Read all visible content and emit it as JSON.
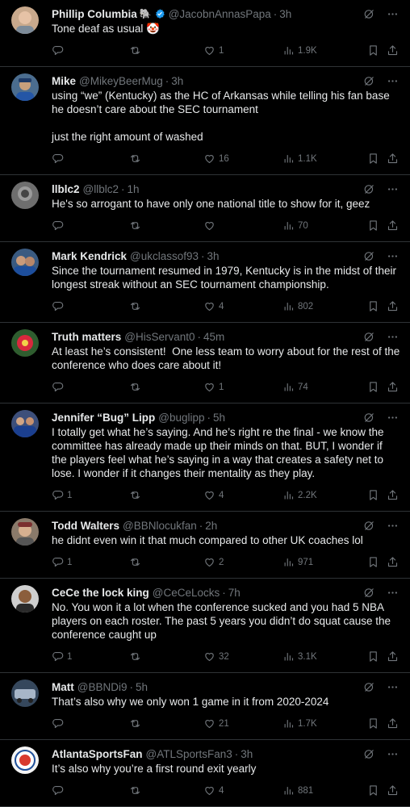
{
  "tweets": [
    {
      "name": "Phillip Columbia",
      "emoji": "🐘",
      "verified": true,
      "handle": "@JacobnAnnasPapa",
      "time": "3h",
      "text": "Tone deaf as usual 🤡",
      "replies": "",
      "retweets": "",
      "likes": "1",
      "views": "1.9K",
      "avatar": "avatar-a"
    },
    {
      "name": "Mike",
      "emoji": "",
      "verified": false,
      "handle": "@MikeyBeerMug",
      "time": "3h",
      "text": "using “we” (Kentucky) as the HC of Arkansas while telling his fan base he doesn’t care about the SEC tournament\n\njust the right amount of washed",
      "replies": "",
      "retweets": "",
      "likes": "16",
      "views": "1.1K",
      "avatar": "avatar-b"
    },
    {
      "name": "llblc2",
      "emoji": "",
      "verified": false,
      "handle": "@llblc2",
      "time": "1h",
      "text": "He's so arrogant to have only one national title to show for it, geez",
      "replies": "",
      "retweets": "",
      "likes": "",
      "views": "70",
      "avatar": "avatar-c"
    },
    {
      "name": "Mark Kendrick",
      "emoji": "",
      "verified": false,
      "handle": "@ukclassof93",
      "time": "3h",
      "text": "Since the tournament resumed in 1979, Kentucky is in the midst of their longest streak without an SEC tournament championship.",
      "replies": "",
      "retweets": "",
      "likes": "4",
      "views": "802",
      "avatar": "avatar-d"
    },
    {
      "name": "Truth matters",
      "emoji": "",
      "verified": false,
      "handle": "@HisServant0",
      "time": "45m",
      "text": "At least he’s consistent!  One less team to worry about for the rest of the conference who does care about it!",
      "replies": "",
      "retweets": "",
      "likes": "1",
      "views": "74",
      "avatar": "avatar-e"
    },
    {
      "name": "Jennifer “Bug” Lipp",
      "emoji": "",
      "verified": false,
      "handle": "@buglipp",
      "time": "5h",
      "text": "I totally get what he’s saying. And he’s right re the final - we know the committee has already made up their minds on that. BUT, I wonder if the players feel what he’s saying in a way that creates a safety net to lose. I wonder if it changes their mentality as they play.",
      "replies": "1",
      "retweets": "",
      "likes": "4",
      "views": "2.2K",
      "avatar": "avatar-f"
    },
    {
      "name": "Todd Walters",
      "emoji": "",
      "verified": false,
      "handle": "@BBNlocukfan",
      "time": "2h",
      "text": "he didnt even win it that much compared to other UK coaches lol",
      "replies": "1",
      "retweets": "",
      "likes": "2",
      "views": "971",
      "avatar": "avatar-g"
    },
    {
      "name": "CeCe the lock king",
      "emoji": "",
      "verified": false,
      "handle": "@CeCeLocks",
      "time": "7h",
      "text": "No. You won it a lot when the conference sucked and you had 5 NBA players on each roster. The past 5 years you didn’t do squat cause the conference caught up",
      "replies": "1",
      "retweets": "",
      "likes": "32",
      "views": "3.1K",
      "avatar": "avatar-h"
    },
    {
      "name": "Matt",
      "emoji": "",
      "verified": false,
      "handle": "@BBNDi9",
      "time": "5h",
      "text": "That’s also why we only won 1 game in it from 2020-2024",
      "replies": "",
      "retweets": "",
      "likes": "21",
      "views": "1.7K",
      "avatar": "avatar-i"
    },
    {
      "name": "AtlantaSportsFan",
      "emoji": "",
      "verified": false,
      "handle": "@ATLSportsFan3",
      "time": "3h",
      "text": "It’s also why you’re a first round exit yearly",
      "replies": "",
      "retweets": "",
      "likes": "4",
      "views": "881",
      "avatar": "avatar-j"
    }
  ],
  "ui": {
    "dot": "·",
    "verified_color": "#1d9bf0",
    "muted_color": "#71767b",
    "border_color": "#2f3336"
  }
}
